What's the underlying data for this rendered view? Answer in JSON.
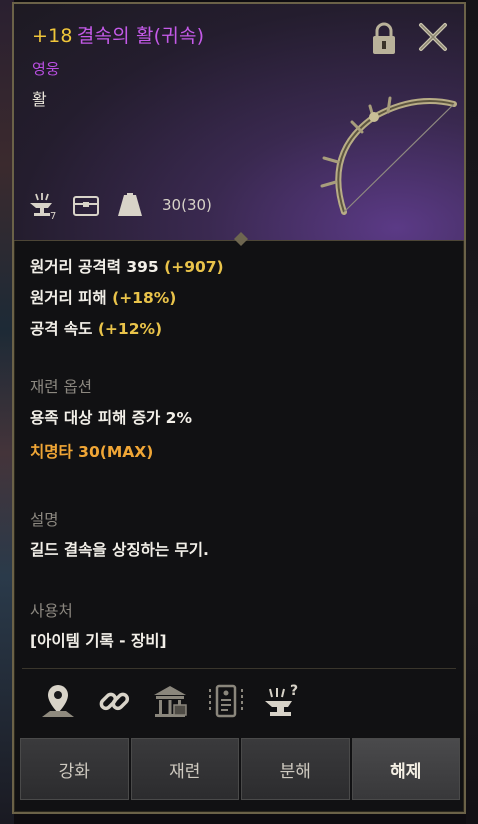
{
  "item": {
    "enhance": "+18",
    "name": "결속의 활(귀속)",
    "grade": "영웅",
    "type": "활",
    "anvil_count": "7",
    "weight": "30(30)"
  },
  "stats": {
    "line1_label": "원거리 공격력 395",
    "line1_bonus": "(+907)",
    "line2_label": "원거리 피해",
    "line2_bonus": "(+18%)",
    "line3_label": "공격 속도",
    "line3_bonus": "(+12%)"
  },
  "reforge": {
    "heading": "재련 옵션",
    "option1": "용족 대상 피해 증가 2%",
    "option2": "치명타 30(MAX)"
  },
  "description": {
    "heading": "설명",
    "text": "길드 결속을 상징하는 무기."
  },
  "usage": {
    "heading": "사용처",
    "text": "[아이템 기록 - 장비]"
  },
  "actions": [
    "강화",
    "재련",
    "분해",
    "해제"
  ],
  "icons": [
    "location-pin-icon",
    "link-icon",
    "warehouse-icon",
    "tag-icon",
    "anvil-question-icon"
  ],
  "colors": {
    "enhance": "#f0c63a",
    "name": "#c45ae8",
    "bonus": "#e9c34a",
    "critical": "#f0a636"
  }
}
